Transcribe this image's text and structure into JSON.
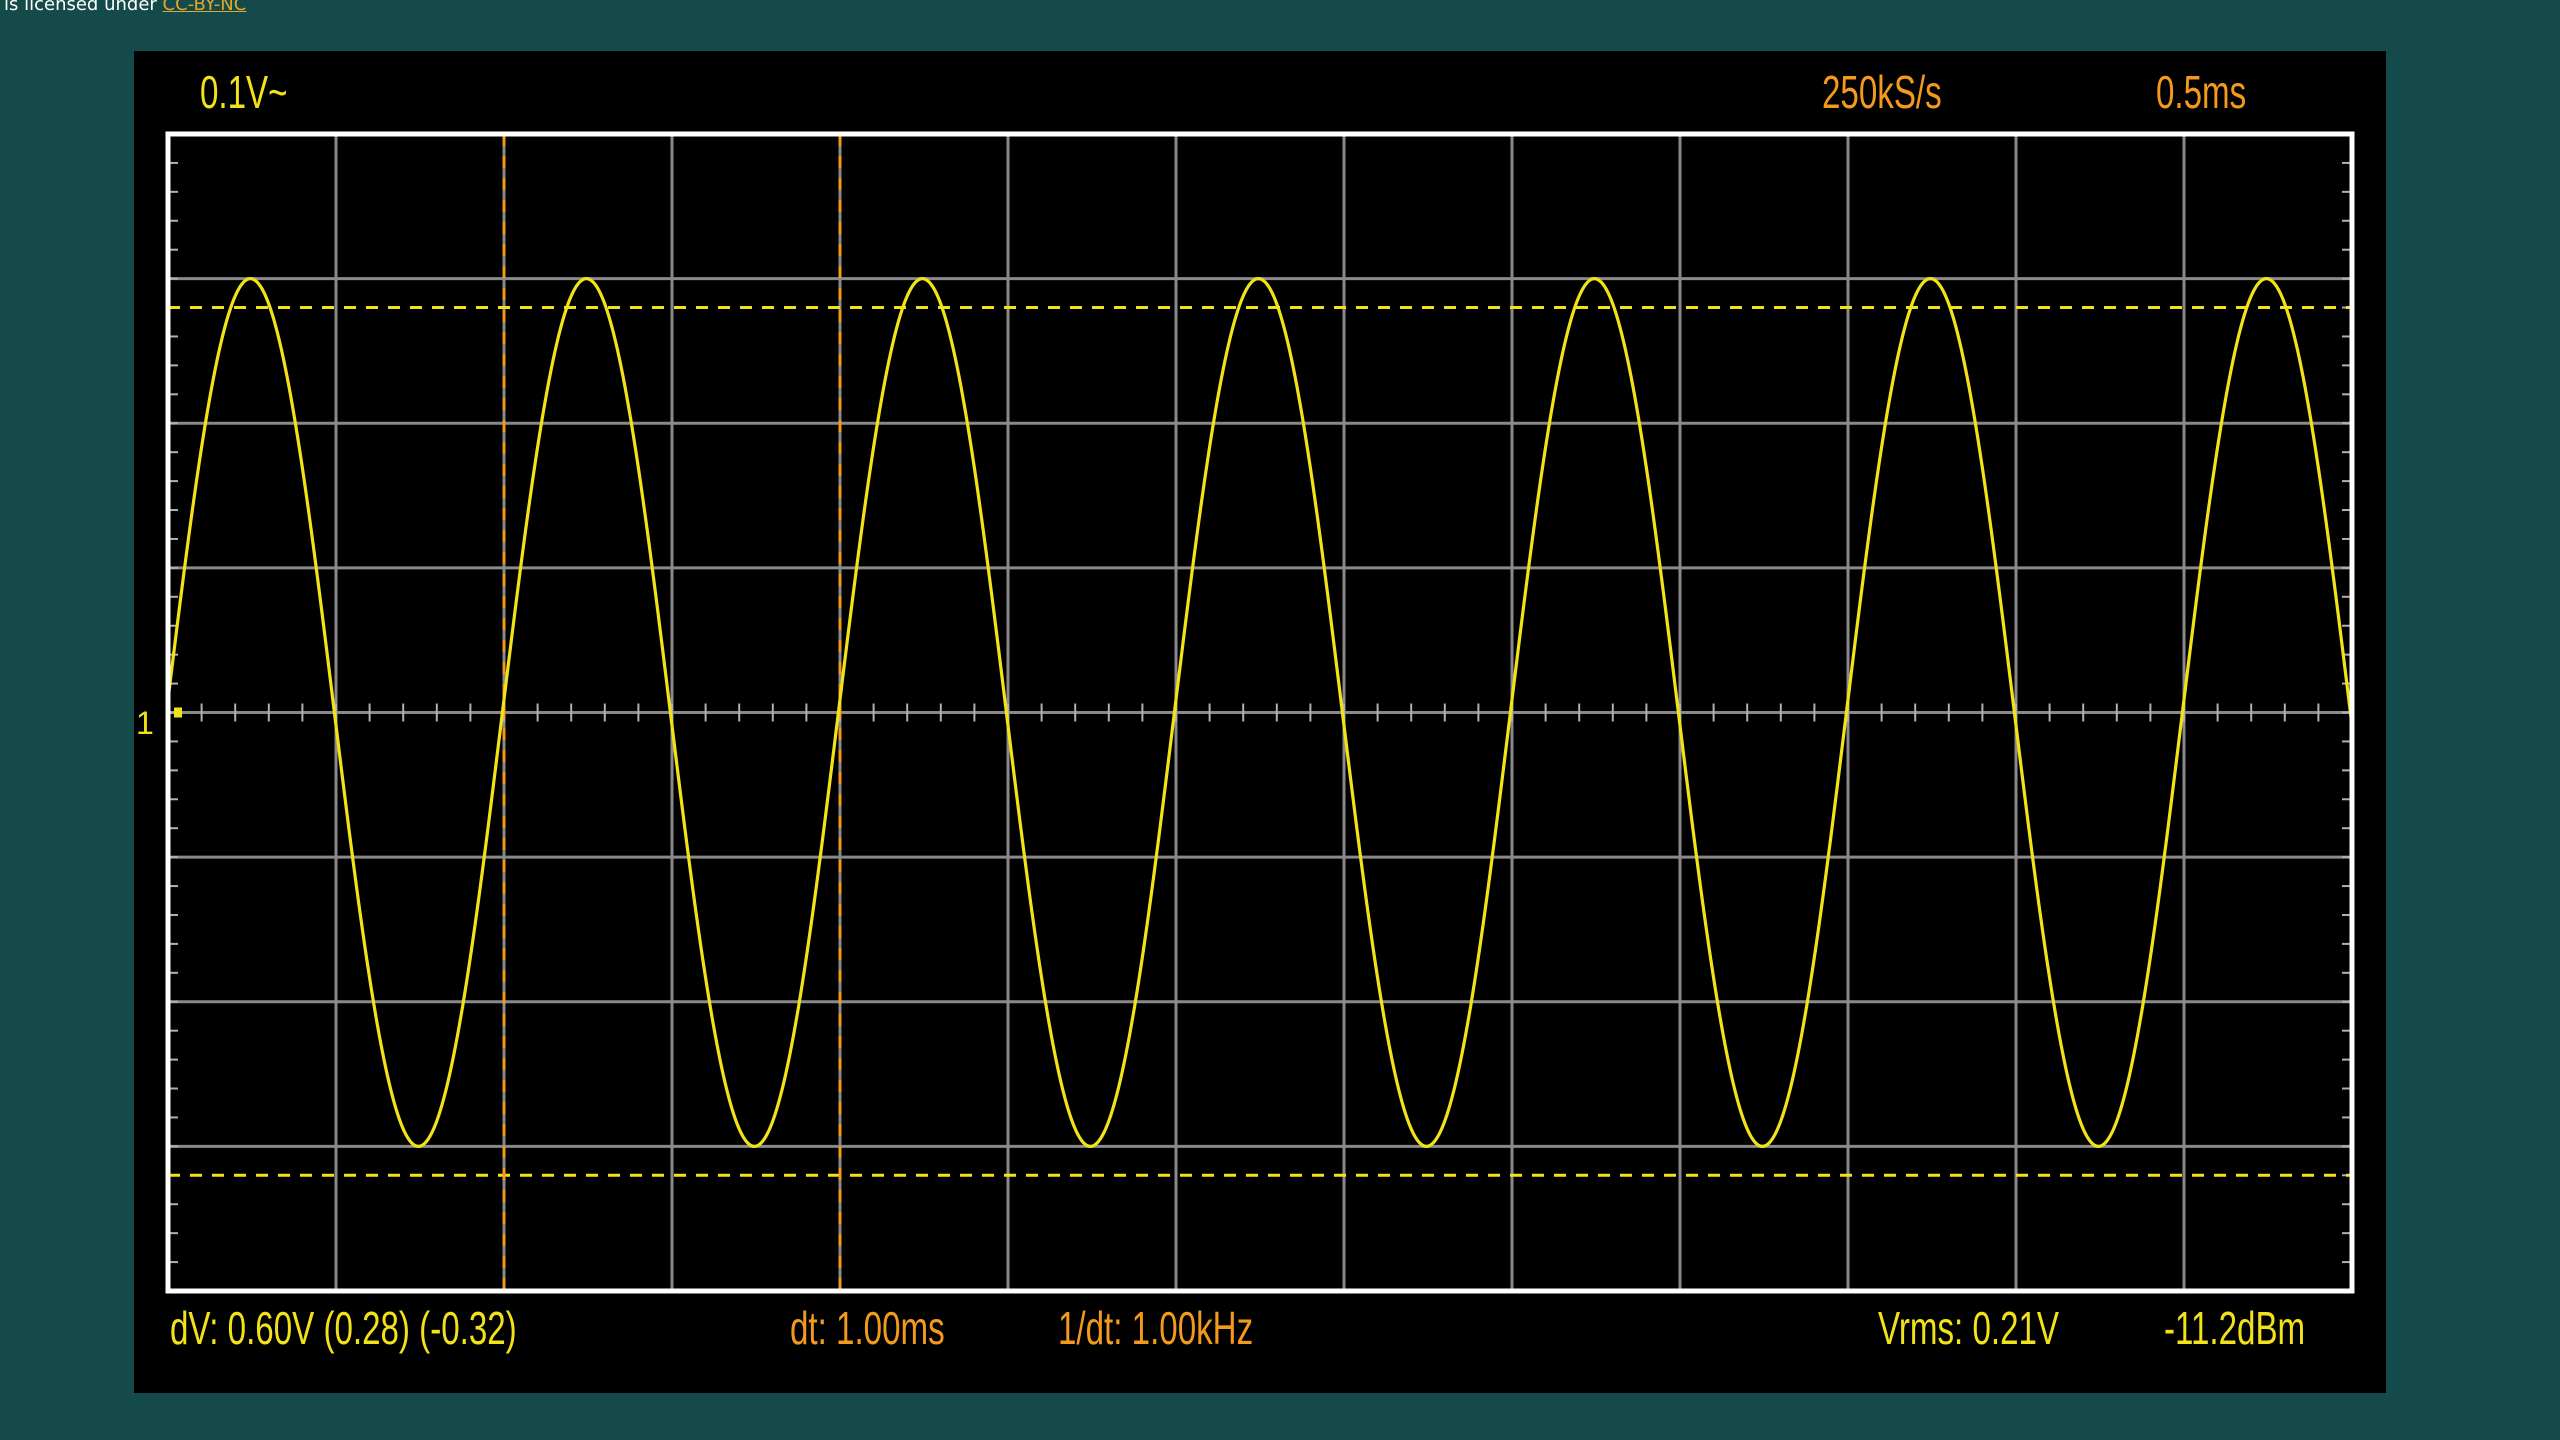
{
  "license": {
    "prefix": "is licensed under",
    "link_text": "CC-BY-NC"
  },
  "header": {
    "volts_per_div": "0.1V~",
    "sample_rate": "250kS/s",
    "time_per_div": "0.5ms"
  },
  "footer": {
    "dv": "dV: 0.60V  (0.28) (-0.32)",
    "dt": "dt: 1.00ms",
    "inv_dt": "1/dt: 1.00kHz",
    "vrms": "Vrms: 0.21V",
    "dbm": "-11.2dBm"
  },
  "channel_marker": "1",
  "colors": {
    "background": "#154a4a",
    "screen": "#000000",
    "trace": "#f2e21a",
    "cursor": "#f39a1d",
    "grid": "#8a8a8a",
    "frame": "#ffffff"
  },
  "chart_data": {
    "type": "line",
    "title": "",
    "xlabel": "",
    "ylabel": "",
    "x_divisions": 13,
    "y_divisions": 8,
    "volts_per_div": 0.1,
    "time_per_div_ms": 0.5,
    "xlim_ms": [
      0,
      6.5
    ],
    "ylim_v": [
      -0.4,
      0.4
    ],
    "grid": true,
    "series": [
      {
        "waveform": "sine",
        "frequency_khz": 1.0,
        "amplitude_v": 0.3,
        "offset_v": 0.0,
        "phase_start": "rising near zero",
        "color": "#f2e21a"
      }
    ],
    "voltage_cursors_v": [
      0.28,
      -0.32
    ],
    "time_cursors_ms": [
      1.0,
      2.0
    ],
    "measurements": {
      "dV_v": 0.6,
      "dt_ms": 1.0,
      "inv_dt_khz": 1.0,
      "vrms_v": 0.21,
      "dbm": -11.2
    }
  }
}
